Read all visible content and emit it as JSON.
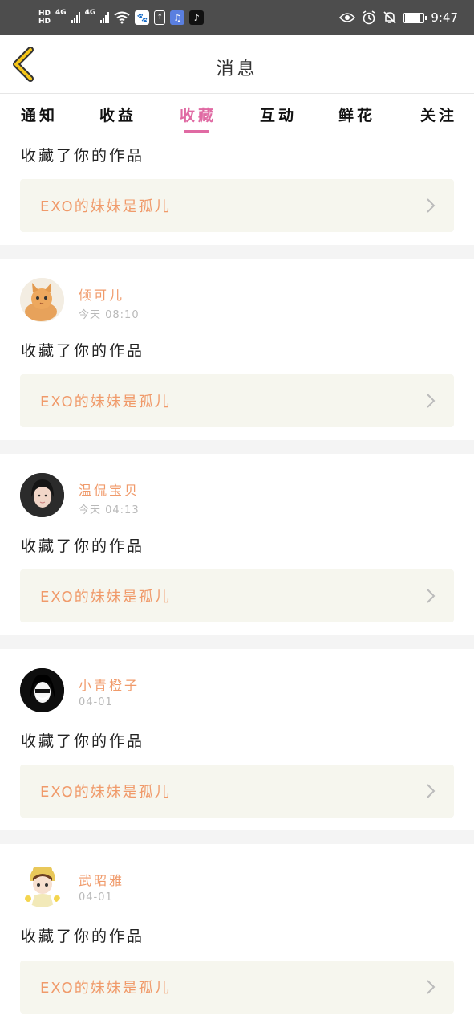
{
  "status_bar": {
    "hd_top": "HD",
    "hd_bottom": "HD",
    "net1": "4G",
    "net2": "4G",
    "time": "9:47",
    "battery_level": 0.8,
    "icons": [
      "hd-icon",
      "signal-icon",
      "wifi-icon",
      "baidu-icon",
      "upload-icon",
      "music-icon",
      "tiktok-icon",
      "eye-icon",
      "alarm-icon",
      "mute-icon",
      "battery-icon"
    ]
  },
  "header": {
    "title": "消息",
    "back_icon": "chevron-left-icon",
    "accent": "#f5c518"
  },
  "tabs": [
    {
      "label": "通知",
      "active": false
    },
    {
      "label": "收益",
      "active": false
    },
    {
      "label": "收藏",
      "active": true
    },
    {
      "label": "互动",
      "active": false
    },
    {
      "label": "鲜花",
      "active": false
    },
    {
      "label": "关注",
      "active": false
    }
  ],
  "colors": {
    "tab_active": "#e06aa3",
    "username": "#f09a6a",
    "work_bg": "#f6f6ee",
    "separator": "#f4f4f4"
  },
  "messages": [
    {
      "user": "",
      "time": "",
      "action": "收藏了你的作品",
      "work": "EXO的妹妹是孤儿"
    },
    {
      "user": "倾可儿",
      "time": "今天 08:10",
      "action": "收藏了你的作品",
      "work": "EXO的妹妹是孤儿",
      "avatar": "kitten"
    },
    {
      "user": "温侃宝贝",
      "time": "今天 04:13",
      "action": "收藏了你的作品",
      "work": "EXO的妹妹是孤儿",
      "avatar": "girl"
    },
    {
      "user": "小青橙子",
      "time": "04-01",
      "action": "收藏了你的作品",
      "work": "EXO的妹妹是孤儿",
      "avatar": "anime-dark"
    },
    {
      "user": "武昭雅",
      "time": "04-01",
      "action": "收藏了你的作品",
      "work": "EXO的妹妹是孤儿",
      "avatar": "cartoon-girl"
    }
  ]
}
